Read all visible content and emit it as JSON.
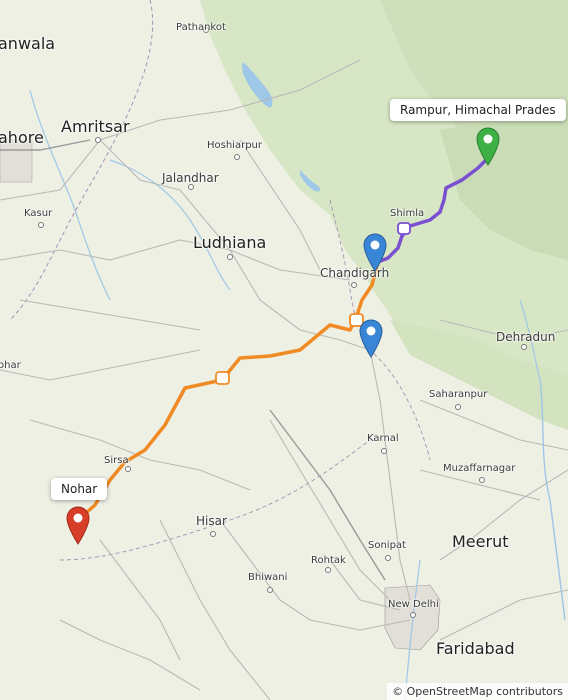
{
  "places": {
    "anwala": "anwala",
    "pathankot": "Pathankot",
    "amritsar": "Amritsar",
    "lahore": "ahore",
    "hoshiarpur": "Hoshiarpur",
    "jalandhar": "Jalandhar",
    "kasur": "Kasur",
    "ludhiana": "Ludhiana",
    "chandigarh": "Chandigarh",
    "shimla": "Shimla",
    "dehradun": "Dehradun",
    "ohar": "ohar",
    "saharanpur": "Saharanpur",
    "karnal": "Karnal",
    "sirsa": "Sirsa",
    "muzaffarnagar": "Muzaffarnagar",
    "hisar": "Hisar",
    "meerut": "Meerut",
    "sonipat": "Sonipat",
    "rohtak": "Rohtak",
    "bhiwani": "Bhiwani",
    "new_delhi": "New Delhi",
    "faridabad": "Faridabad"
  },
  "callouts": {
    "destination": "Rampur, Himachal Prades",
    "origin": "Nohar"
  },
  "markers": {
    "origin_color": "#d63e2a",
    "waypoint_color": "#3a86d6",
    "destination_color": "#3cb043"
  },
  "route": {
    "segment_1_color": "#f08a24",
    "segment_2_color": "#7b4fd1"
  },
  "attribution": "© OpenStreetMap contributors"
}
